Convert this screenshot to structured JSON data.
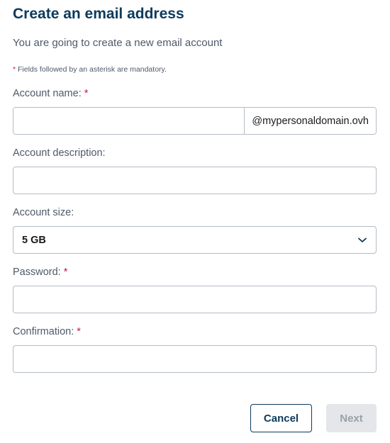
{
  "header": {
    "title": "Create an email address",
    "subtitle": "You are going to create a new email account"
  },
  "mandatory_note": {
    "asterisk": "*",
    "text": " Fields followed by an asterisk are mandatory."
  },
  "form": {
    "account_name": {
      "label": "Account name:",
      "required_mark": "*",
      "value": "",
      "domain_suffix": "@mypersonaldomain.ovh"
    },
    "account_description": {
      "label": "Account description:",
      "value": ""
    },
    "account_size": {
      "label": "Account size:",
      "selected": "5 GB",
      "icon": "chevron-down-icon"
    },
    "password": {
      "label": "Password:",
      "required_mark": "*",
      "value": ""
    },
    "confirmation": {
      "label": "Confirmation:",
      "required_mark": "*",
      "value": ""
    }
  },
  "actions": {
    "cancel_label": "Cancel",
    "next_label": "Next",
    "next_enabled": false
  },
  "colors": {
    "title": "#0d3a5c",
    "asterisk": "#d4173a",
    "cancel_border": "#0d3a5c",
    "next_disabled_bg": "#e4e6e9"
  }
}
